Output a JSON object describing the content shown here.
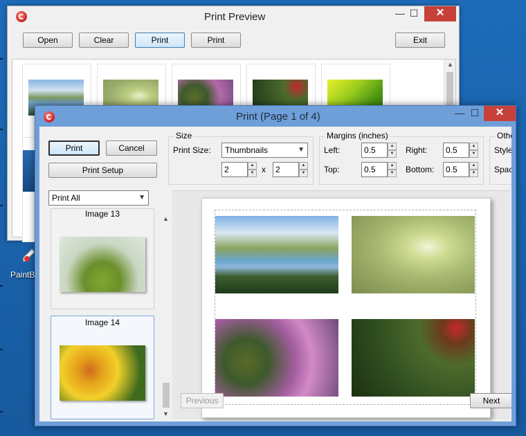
{
  "background_window": {
    "title": "Print Preview",
    "buttons": [
      "Open",
      "Clear",
      "Print",
      "Print",
      "Exit"
    ],
    "minimize": "—",
    "maximize": "☐",
    "close": "✕"
  },
  "desktop": {
    "icon_label": "PaintB"
  },
  "dialog": {
    "title": "Print (Page 1 of 4)",
    "minimize": "—",
    "maximize": "☐",
    "close": "✕",
    "print_button": "Print",
    "cancel_button": "Cancel",
    "setup_button": "Print Setup",
    "range_select": "Print All",
    "size_group": {
      "label": "Size",
      "print_size_label": "Print Size:",
      "print_size_value": "Thumbnails",
      "cols": "2",
      "times": "x",
      "rows": "2"
    },
    "margins_group": {
      "label": "Margins (inches)",
      "left_label": "Left:",
      "left": "0.5",
      "right_label": "Right:",
      "right": "0.5",
      "top_label": "Top:",
      "top": "0.5",
      "bottom_label": "Bottom:",
      "bottom": "0.5"
    },
    "other_group": {
      "label": "Othe",
      "style_label": "Style:",
      "spacing_label": "Spaci"
    },
    "image_list": [
      {
        "caption": "Image 13"
      },
      {
        "caption": "Image 14"
      }
    ],
    "previous_button": "Previous",
    "next_button": "Next"
  },
  "colors": {
    "desktop": "#1a5fa8",
    "dialog_title_bar": "#6f9fd9",
    "close_button": "#c7413a"
  }
}
